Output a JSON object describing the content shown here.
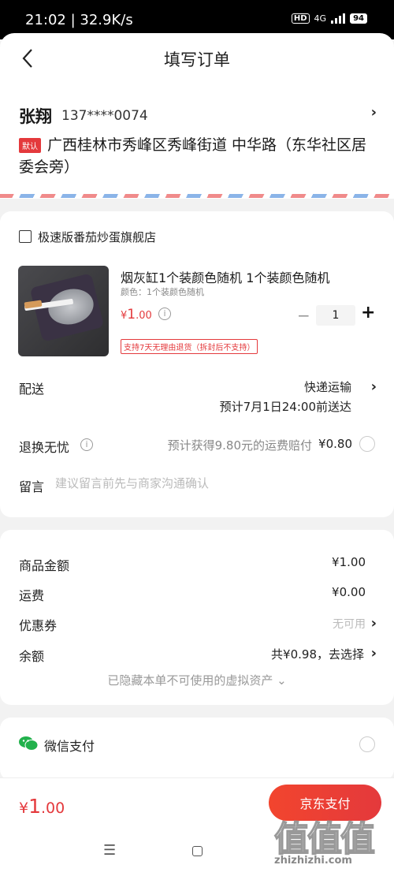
{
  "status_bar": {
    "time": "21:02 | 32.9K/s",
    "hd": "HD",
    "network": "4G",
    "battery": "94"
  },
  "header": {
    "title": "填写订单"
  },
  "address": {
    "name": "张翔",
    "phone": "137****0074",
    "default_badge": "默认",
    "full_address": "广西桂林市秀峰区秀峰街道 中华路（东华社区居委会旁）"
  },
  "shop": {
    "name": "极速版番茄炒蛋旗舰店",
    "product": {
      "title": "烟灰缸1个装颜色随机 1个装颜色随机",
      "spec": "颜色：1个装颜色随机",
      "price_symbol": "¥",
      "price_int": "1",
      "price_dec": ".00",
      "quantity": "1",
      "return_tag": "支持7天无理由退货（拆封后不支持）"
    },
    "shipping": {
      "label": "配送",
      "method": "快递运输",
      "eta": "预计7月1日24:00前送达"
    },
    "return_insurance": {
      "label": "退换无忧",
      "desc": "预计获得9.80元的运费赔付",
      "price": "¥0.80"
    },
    "message": {
      "label": "留言",
      "placeholder": "建议留言前先与商家沟通确认"
    }
  },
  "summary": {
    "goods_label": "商品金额",
    "goods_value": "¥1.00",
    "shipping_label": "运费",
    "shipping_value": "¥0.00",
    "coupon_label": "优惠券",
    "coupon_value": "无可用",
    "balance_label": "余额",
    "balance_value": "共¥0.98，去选择",
    "hidden_assets": "已隐藏本单不可使用的虚拟资产 ⌄"
  },
  "payment": {
    "wechat_label": "微信支付"
  },
  "bottom": {
    "total_symbol": "¥",
    "total_int": "1",
    "total_dec": ".00",
    "pay_button": "京东支付"
  },
  "nav": {
    "menu": "☰",
    "back": "‹"
  },
  "watermark": {
    "glyphs": "值值值",
    "domain": "zhizhizhi.com"
  },
  "colors": {
    "accent": "#e4393c",
    "wechat": "#22b14c"
  }
}
